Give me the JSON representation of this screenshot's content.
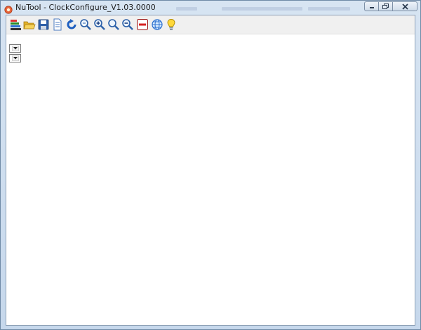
{
  "window": {
    "title": "NuTool - ClockConfigure_V1.03.0000"
  },
  "toolbar": {
    "buttons": [
      {
        "icon": "clock-tree-icon"
      },
      {
        "icon": "open-folder-icon"
      },
      {
        "icon": "save-icon"
      },
      {
        "icon": "document-icon"
      },
      {
        "icon": "refresh-icon"
      },
      {
        "icon": "zoom-fit-icon"
      },
      {
        "icon": "zoom-in-icon"
      },
      {
        "icon": "zoom-icon"
      },
      {
        "icon": "zoom-out-icon"
      },
      {
        "icon": "stop-icon"
      },
      {
        "icon": "globe-icon"
      },
      {
        "icon": "lightbulb-icon"
      }
    ]
  },
  "colors": {
    "toolbar_bg": "#f0f0f0",
    "accent_blue": "#1f6fd1",
    "stop_red": "#d62020"
  }
}
